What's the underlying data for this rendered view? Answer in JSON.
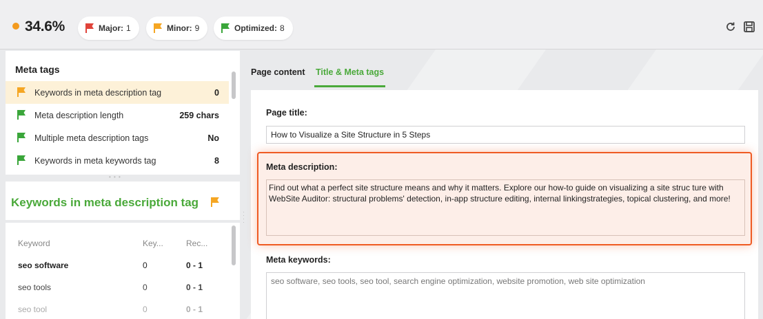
{
  "topbar": {
    "score": "34.6%",
    "score_color": "#f39a1e",
    "pills": [
      {
        "label": "Major:",
        "count": "1",
        "flag": "red-flag-icon"
      },
      {
        "label": "Minor:",
        "count": "9",
        "flag": "orange-flag-icon"
      },
      {
        "label": "Optimized:",
        "count": "8",
        "flag": "green-flag-icon"
      }
    ],
    "icons": [
      "refresh-icon",
      "save-icon"
    ]
  },
  "meta_tags": {
    "title": "Meta tags",
    "rows": [
      {
        "label": "Keywords in meta description tag",
        "value": "0",
        "flag": "orange",
        "selected": true
      },
      {
        "label": "Meta description length",
        "value": "259 chars",
        "flag": "green"
      },
      {
        "label": "Multiple meta description tags",
        "value": "No",
        "flag": "green"
      },
      {
        "label": "Keywords in meta keywords tag",
        "value": "8",
        "flag": "green"
      }
    ]
  },
  "detail": {
    "title": "Keywords in meta description tag",
    "table": {
      "headers": [
        "Keyword",
        "Key...",
        "Rec..."
      ],
      "rows": [
        [
          "seo software",
          "0",
          "0 - 1"
        ],
        [
          "seo tools",
          "0",
          "0 - 1"
        ],
        [
          "seo tool",
          "0",
          "0 - 1"
        ]
      ]
    }
  },
  "tabs": [
    {
      "label": "Page content",
      "active": false
    },
    {
      "label": "Title & Meta tags",
      "active": true
    }
  ],
  "fields": {
    "page_title_label": "Page title:",
    "page_title_value": "How to Visualize a Site Structure in 5 Steps",
    "meta_description_label": "Meta description:",
    "meta_description_value": "Find out what a perfect site structure means and why it matters. Explore our how-to guide on visualizing a site struc ture with WebSite Auditor: structural problems' detection, in-app structure editing, internal linkingstrategies, topical clustering, and more!",
    "meta_keywords_label": "Meta keywords:",
    "meta_keywords_value": "seo software, seo tools, seo tool, search engine optimization, website promotion, web site optimization"
  },
  "colors": {
    "accent_green": "#4aa93a",
    "highlight_orange": "#ef5a22",
    "flag_red": "#e0433a",
    "flag_orange": "#f5a623",
    "flag_green": "#3aa63a"
  }
}
